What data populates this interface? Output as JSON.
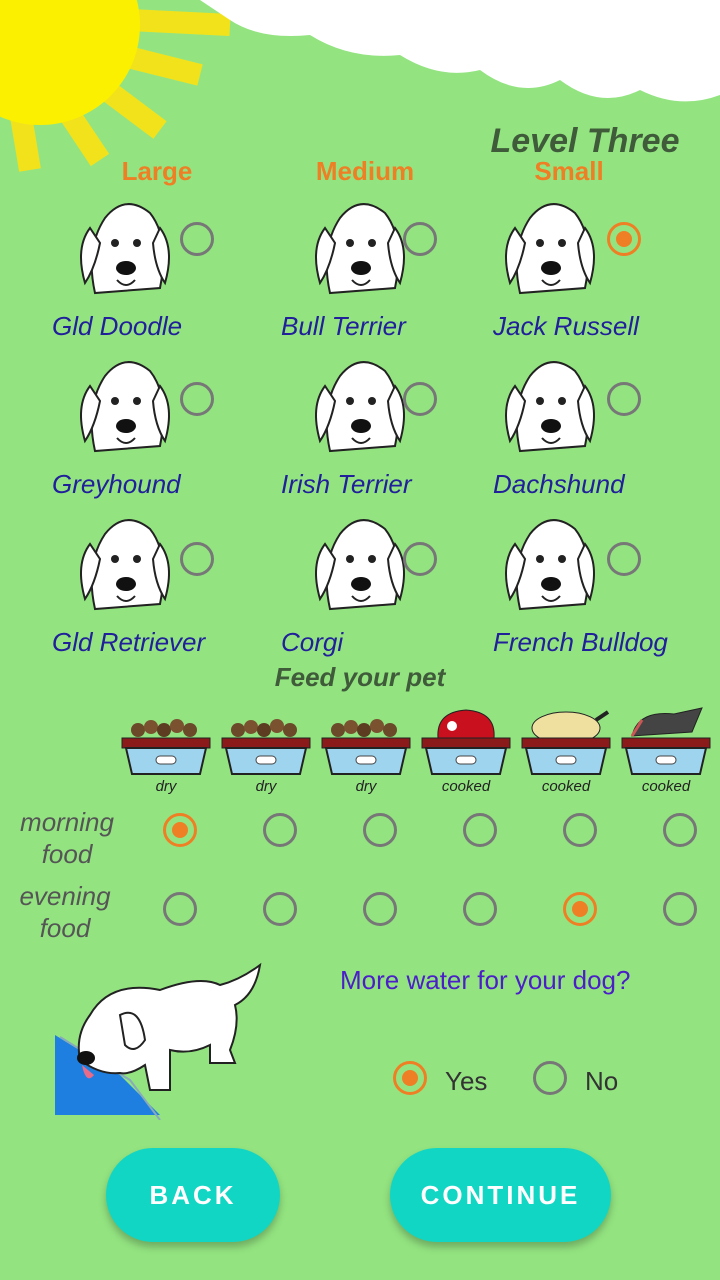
{
  "header": {
    "level": "Level Three"
  },
  "sizes": [
    "Large",
    "Medium",
    "Small"
  ],
  "dogs": [
    {
      "name": "Gld Doodle",
      "selected": false
    },
    {
      "name": "Bull Terrier",
      "selected": false
    },
    {
      "name": "Jack Russell",
      "selected": true
    },
    {
      "name": "Greyhound",
      "selected": false
    },
    {
      "name": "Irish Terrier",
      "selected": false
    },
    {
      "name": "Dachshund",
      "selected": false
    },
    {
      "name": "Gld Retriever",
      "selected": false
    },
    {
      "name": "Corgi",
      "selected": false
    },
    {
      "name": "French Bulldog",
      "selected": false
    }
  ],
  "feed": {
    "title": "Feed your pet",
    "bowls": [
      "dry",
      "dry",
      "dry",
      "cooked",
      "cooked",
      "cooked"
    ],
    "morning_label": "morning\nfood",
    "evening_label": "evening\nfood",
    "morning_selected_index": 0,
    "evening_selected_index": 4
  },
  "water": {
    "question": "More water for your dog?",
    "yes": "Yes",
    "no": "No",
    "selected": "yes"
  },
  "buttons": {
    "back": "BACK",
    "continue": "CONTINUE"
  },
  "colors": {
    "background": "#93e481",
    "accent": "#ef7f24",
    "button": "#12d6c4",
    "dog_label": "#21209a"
  }
}
